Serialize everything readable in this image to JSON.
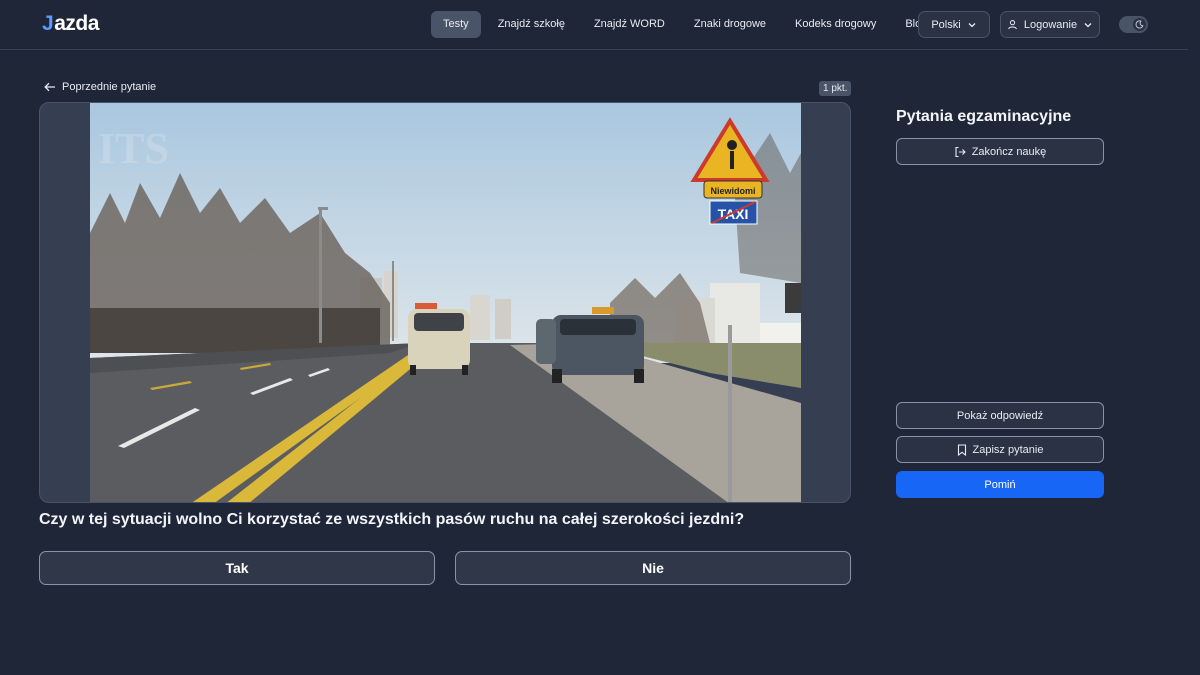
{
  "header": {
    "logo_mark": "J",
    "logo_text": "azda",
    "nav": [
      {
        "label": "Testy",
        "active": true
      },
      {
        "label": "Znajdź szkołę",
        "active": false
      },
      {
        "label": "Znajdź WORD",
        "active": false
      },
      {
        "label": "Znaki drogowe",
        "active": false
      },
      {
        "label": "Kodeks drogowy",
        "active": false
      },
      {
        "label": "Blog",
        "active": false
      }
    ],
    "language": "Polski",
    "login": "Logowanie",
    "theme_icon": "moon-icon"
  },
  "question": {
    "back_label": "Poprzednie pytanie",
    "points": "1 pkt.",
    "text": "Czy w tej sytuacji wolno Ci korzystać ze wszystkich pasów ruchu na całej szerokości jezdni?",
    "answers": [
      "Tak",
      "Nie"
    ],
    "image_sign_text": "Niewidomi",
    "image_sign_text_2": "TAXI"
  },
  "sidebar": {
    "title": "Pytania egzaminacyjne",
    "end_label": "Zakończ naukę",
    "show_answer_label": "Pokaż odpowiedź",
    "save_label": "Zapisz pytanie",
    "skip_label": "Pomiń"
  },
  "colors": {
    "background": "#1f2637",
    "accent": "#1766f5",
    "logo_accent": "#5b9bff"
  }
}
